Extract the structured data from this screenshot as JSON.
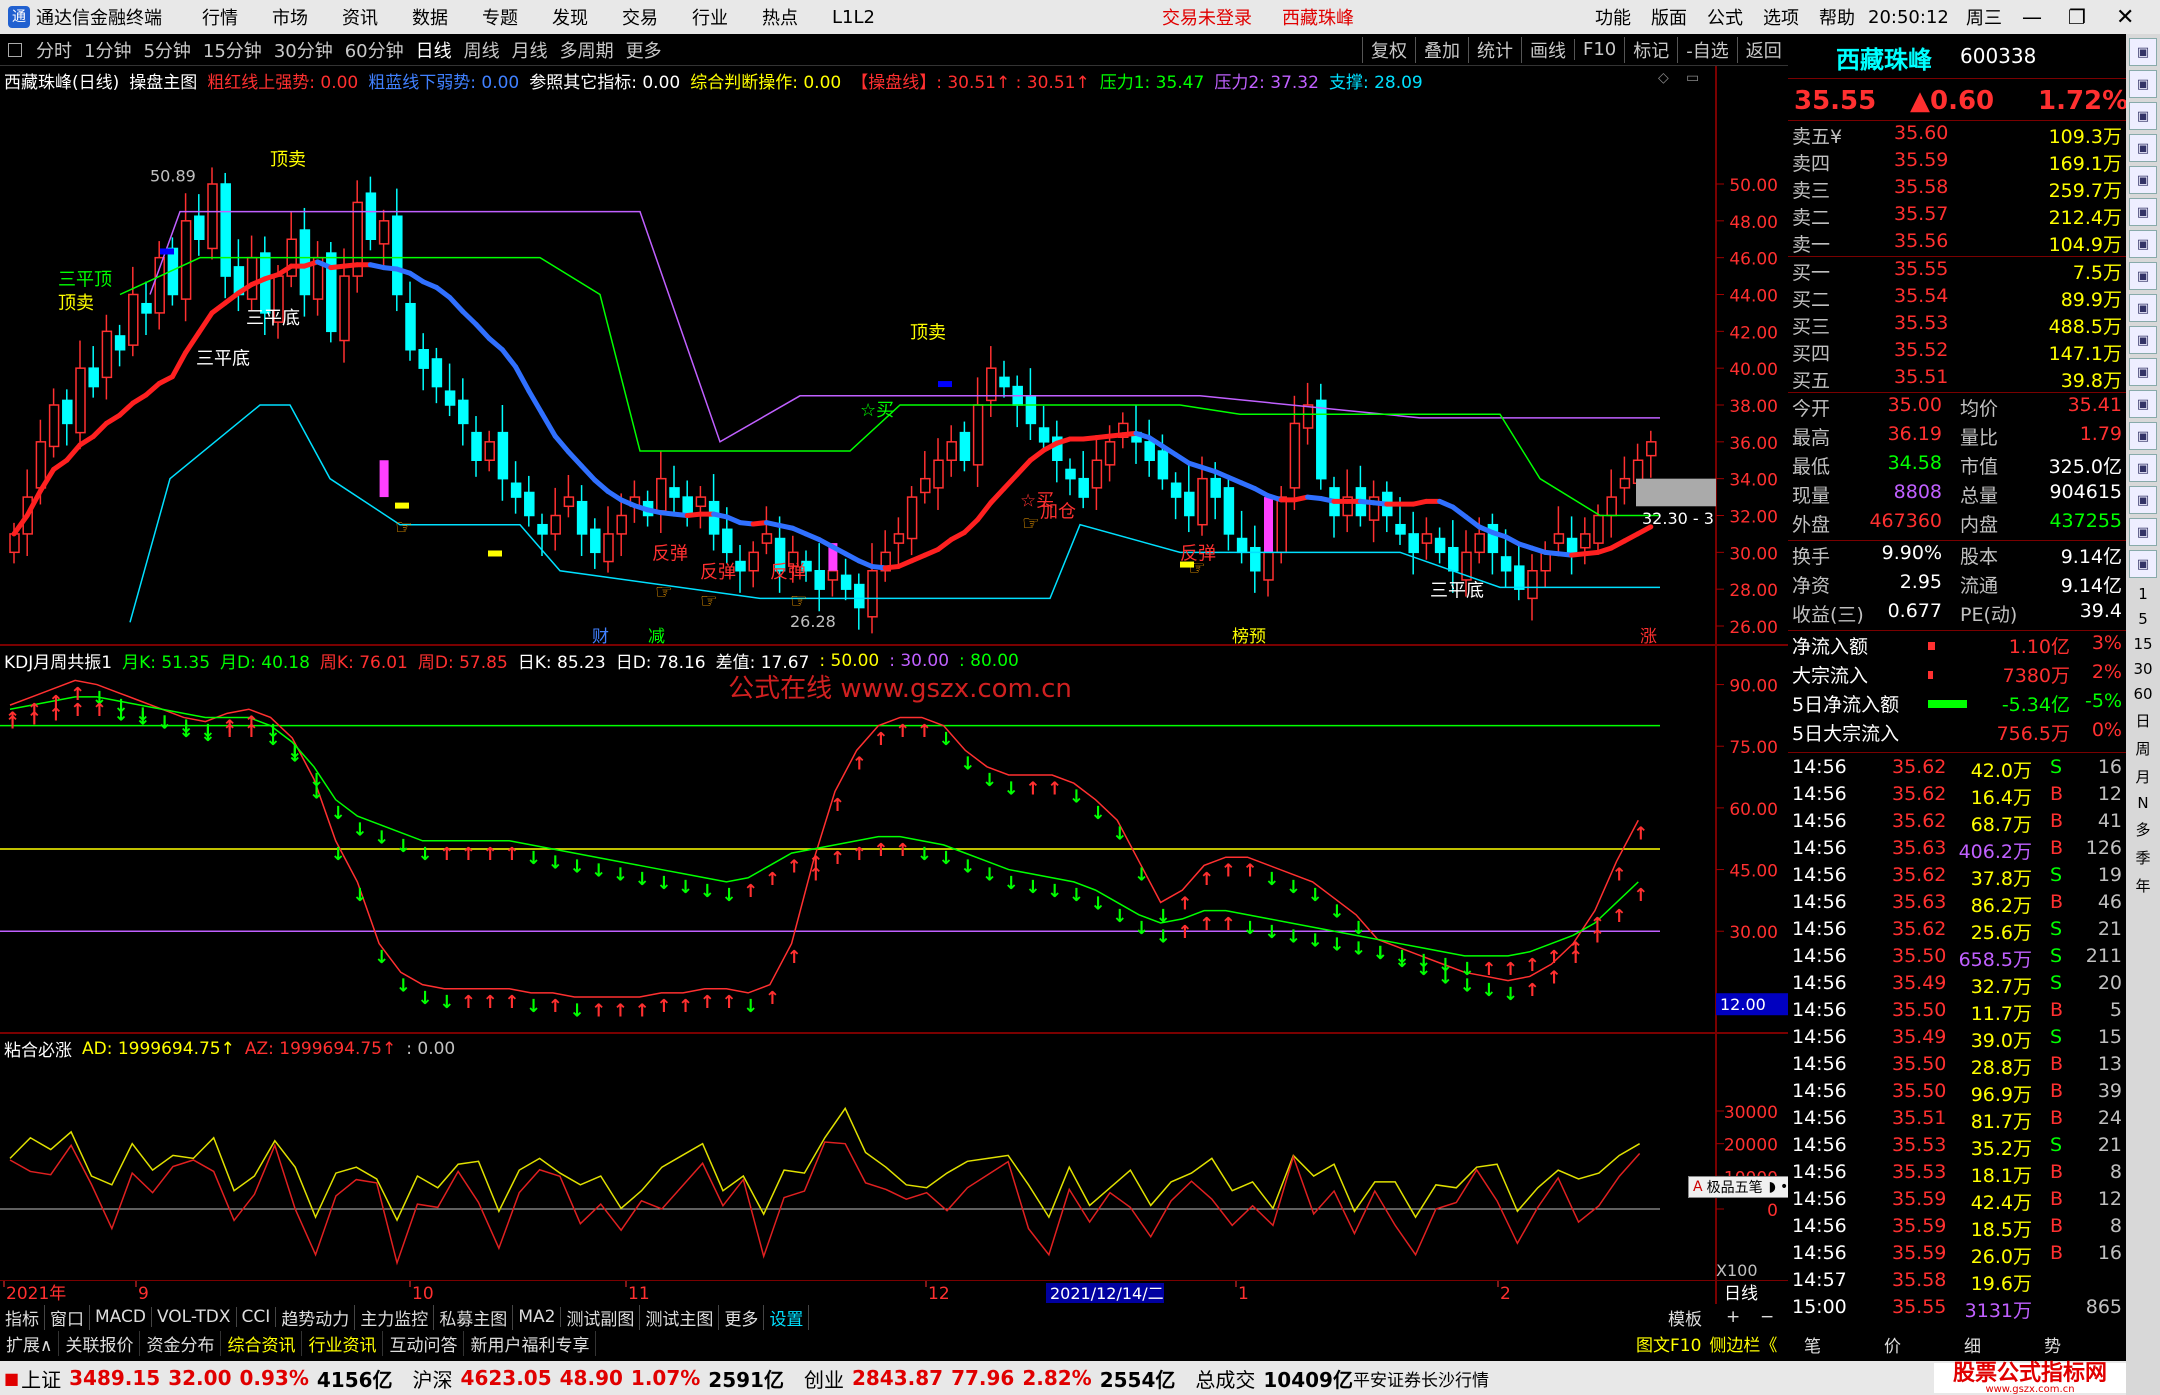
{
  "app": {
    "title": "通达信金融终端",
    "menus": [
      "行情",
      "市场",
      "资讯",
      "数据",
      "专题",
      "发现",
      "交易",
      "行业",
      "热点",
      "L1L2"
    ],
    "login_status": "交易未登录",
    "stock_tab": "西藏珠峰",
    "right_menus": [
      "功能",
      "版面",
      "公式",
      "选项",
      "帮助"
    ],
    "clock": "20:50:12",
    "weekday": "周三"
  },
  "toolbar": {
    "periods": [
      "分时",
      "1分钟",
      "5分钟",
      "15分钟",
      "30分钟",
      "60分钟",
      "日线",
      "周线",
      "月线",
      "多周期",
      "更多"
    ],
    "active": "日线",
    "right": [
      "复权",
      "叠加",
      "统计",
      "画线",
      "F10",
      "标记",
      "-自选",
      "返回"
    ]
  },
  "main_panel": {
    "title_items": [
      {
        "text": "西藏珠峰(日线)",
        "color": "#ffffff"
      },
      {
        "text": "操盘主图",
        "color": "#ffffff"
      },
      {
        "text": "粗红线上强势: 0.00",
        "color": "#ff3030"
      },
      {
        "text": "粗蓝线下弱势: 0.00",
        "color": "#4080ff"
      },
      {
        "text": "参照其它指标: 0.00",
        "color": "#ffffff"
      },
      {
        "text": "综合判断操作: 0.00",
        "color": "#ffff00"
      },
      {
        "text": "【操盘线】: 30.51↑ : 30.51↑",
        "color": "#ff3030"
      },
      {
        "text": "压力1: 35.47",
        "color": "#00ff00"
      },
      {
        "text": "压力2: 37.32",
        "color": "#c060ff"
      },
      {
        "text": "支撑: 28.09",
        "color": "#00e0ff"
      }
    ],
    "y_ticks": [
      "50.00",
      "48.00",
      "46.00",
      "44.00",
      "42.00",
      "40.00",
      "38.00",
      "36.00",
      "34.00",
      "32.00",
      "30.00",
      "28.00",
      "26.00"
    ],
    "high_label": "50.89",
    "low_label": "26.28",
    "price_box": "32.30 - 3",
    "signals": [
      {
        "text": "三平顶",
        "color": "#00ff00"
      },
      {
        "text": "顶卖",
        "color": "#ffff00"
      },
      {
        "text": "顶卖",
        "color": "#ffff00"
      },
      {
        "text": "三平底",
        "color": "#ffffff"
      },
      {
        "text": "三平底",
        "color": "#ffffff"
      },
      {
        "text": "顶卖",
        "color": "#ffff00"
      },
      {
        "text": "☆买",
        "color": "#00ff00"
      },
      {
        "text": "反弹",
        "color": "#ff3030"
      },
      {
        "text": "反弹",
        "color": "#ff3030"
      },
      {
        "text": "反弹",
        "color": "#ff3030"
      },
      {
        "text": "☆买",
        "color": "#ff3030"
      },
      {
        "text": "加仓",
        "color": "#ff3030"
      },
      {
        "text": "反弹",
        "color": "#ff3030"
      },
      {
        "text": "三平底",
        "color": "#ffffff"
      }
    ],
    "bottom_marks": [
      {
        "text": "财",
        "color": "#4080ff"
      },
      {
        "text": "减",
        "color": "#00ff00"
      },
      {
        "text": "榜预",
        "color": "#ffff00"
      },
      {
        "text": "涨",
        "color": "#ff3030"
      }
    ]
  },
  "kdj_panel": {
    "title_items": [
      {
        "text": "KDJ月周共振1",
        "color": "#ffffff"
      },
      {
        "text": "月K: 51.35",
        "color": "#00ff00"
      },
      {
        "text": "月D: 40.18",
        "color": "#00ff00"
      },
      {
        "text": "周K: 76.01",
        "color": "#ff3030"
      },
      {
        "text": "周D: 57.85",
        "color": "#ff3030"
      },
      {
        "text": "日K: 85.23",
        "color": "#ffffff"
      },
      {
        "text": "日D: 78.16",
        "color": "#ffffff"
      },
      {
        "text": "差值: 17.67",
        "color": "#ffffff"
      },
      {
        "text": ": 50.00",
        "color": "#ffff00"
      },
      {
        "text": ": 30.00",
        "color": "#c060ff"
      },
      {
        "text": ": 80.00",
        "color": "#00ff00"
      }
    ],
    "y_ticks": [
      "90.00",
      "75.00",
      "60.00",
      "45.00",
      "30.00"
    ],
    "side_value": "12.00",
    "watermark": "公式在线  www.gszx.com.cn"
  },
  "ad_panel": {
    "title_items": [
      {
        "text": "粘合必涨",
        "color": "#ffffff"
      },
      {
        "text": "AD: 1999694.75↑",
        "color": "#ffff00"
      },
      {
        "text": "AZ: 1999694.75↑",
        "color": "#ff3030"
      },
      {
        "text": ": 0.00",
        "color": "#c0c0c0"
      }
    ],
    "y_ticks": [
      "30000",
      "20000",
      "10000",
      "0"
    ],
    "multiplier": "X100",
    "overlay": [
      "极品五笔"
    ]
  },
  "x_axis": {
    "labels": [
      "2021年",
      "9",
      "10",
      "11",
      "12",
      "1",
      "2"
    ],
    "cursor": "2021/12/14/二",
    "period": "日线"
  },
  "quote": {
    "name": "西藏珠峰",
    "code": "600338",
    "price": "35.55",
    "change": "▲0.60",
    "pct": "1.72%",
    "asks": [
      {
        "label": "卖五¥",
        "price": "35.60",
        "vol": "109.3万"
      },
      {
        "label": "卖四",
        "price": "35.59",
        "vol": "169.1万"
      },
      {
        "label": "卖三",
        "price": "35.58",
        "vol": "259.7万"
      },
      {
        "label": "卖二",
        "price": "35.57",
        "vol": "212.4万"
      },
      {
        "label": "卖一",
        "price": "35.56",
        "vol": "104.9万"
      }
    ],
    "bids": [
      {
        "label": "买一",
        "price": "35.55",
        "vol": "7.5万"
      },
      {
        "label": "买二",
        "price": "35.54",
        "vol": "89.9万"
      },
      {
        "label": "买三",
        "price": "35.53",
        "vol": "488.5万"
      },
      {
        "label": "买四",
        "price": "35.52",
        "vol": "147.1万"
      },
      {
        "label": "买五",
        "price": "35.51",
        "vol": "39.8万"
      }
    ],
    "stats": [
      {
        "l1": "今开",
        "v1": "35.00",
        "c1": "#ff3030",
        "l2": "均价",
        "v2": "35.41",
        "c2": "#ff3030"
      },
      {
        "l1": "最高",
        "v1": "36.19",
        "c1": "#ff3030",
        "l2": "量比",
        "v2": "1.79",
        "c2": "#ff3030"
      },
      {
        "l1": "最低",
        "v1": "34.58",
        "c1": "#00ff00",
        "l2": "市值",
        "v2": "325.0亿",
        "c2": "#ffffff"
      },
      {
        "l1": "现量",
        "v1": "8808",
        "c1": "#c060ff",
        "l2": "总量",
        "v2": "904615",
        "c2": "#ffffff"
      },
      {
        "l1": "外盘",
        "v1": "467360",
        "c1": "#ff3030",
        "l2": "内盘",
        "v2": "437255",
        "c2": "#00ff00"
      }
    ],
    "stats2": [
      {
        "l1": "换手",
        "v1": "9.90%",
        "c1": "#ffffff",
        "l2": "股本",
        "v2": "9.14亿",
        "c2": "#ffffff"
      },
      {
        "l1": "净资",
        "v1": "2.95",
        "c1": "#ffffff",
        "l2": "流通",
        "v2": "9.14亿",
        "c2": "#ffffff"
      },
      {
        "l1": "收益(三)",
        "v1": "0.677",
        "c1": "#ffffff",
        "l2": "PE(动)",
        "v2": "39.4",
        "c2": "#ffffff"
      }
    ],
    "flows": [
      {
        "label": "净流入额",
        "value": "1.10亿",
        "pct": "3%",
        "color": "#ff3030",
        "bar": 0.1
      },
      {
        "label": "大宗流入",
        "value": "7380万",
        "pct": "2%",
        "color": "#ff3030",
        "bar": 0.07
      },
      {
        "label": "5日净流入额",
        "value": "-5.34亿",
        "pct": "-5%",
        "color": "#00ff00",
        "bar": 0.55
      },
      {
        "label": "5日大宗流入",
        "value": "756.5万",
        "pct": "0%",
        "color": "#ff3030",
        "bar": 0
      }
    ],
    "ticks": [
      {
        "t": "14:56",
        "p": "35.62",
        "v": "42.0万",
        "s": "S",
        "n": "16",
        "vc": "#ffff00"
      },
      {
        "t": "14:56",
        "p": "35.62",
        "v": "16.4万",
        "s": "B",
        "n": "12",
        "vc": "#ffff00"
      },
      {
        "t": "14:56",
        "p": "35.62",
        "v": "68.7万",
        "s": "B",
        "n": "41",
        "vc": "#ffff00"
      },
      {
        "t": "14:56",
        "p": "35.63",
        "v": "406.2万",
        "s": "B",
        "n": "126",
        "vc": "#c060ff"
      },
      {
        "t": "14:56",
        "p": "35.62",
        "v": "37.8万",
        "s": "S",
        "n": "19",
        "vc": "#ffff00"
      },
      {
        "t": "14:56",
        "p": "35.63",
        "v": "86.2万",
        "s": "B",
        "n": "46",
        "vc": "#ffff00"
      },
      {
        "t": "14:56",
        "p": "35.62",
        "v": "25.6万",
        "s": "S",
        "n": "21",
        "vc": "#ffff00"
      },
      {
        "t": "14:56",
        "p": "35.50",
        "v": "658.5万",
        "s": "S",
        "n": "211",
        "vc": "#c060ff"
      },
      {
        "t": "14:56",
        "p": "35.49",
        "v": "32.7万",
        "s": "S",
        "n": "20",
        "vc": "#ffff00"
      },
      {
        "t": "14:56",
        "p": "35.50",
        "v": "11.7万",
        "s": "B",
        "n": "5",
        "vc": "#ffff00"
      },
      {
        "t": "14:56",
        "p": "35.49",
        "v": "39.0万",
        "s": "S",
        "n": "15",
        "vc": "#ffff00"
      },
      {
        "t": "14:56",
        "p": "35.50",
        "v": "28.8万",
        "s": "B",
        "n": "13",
        "vc": "#ffff00"
      },
      {
        "t": "14:56",
        "p": "35.50",
        "v": "96.9万",
        "s": "B",
        "n": "39",
        "vc": "#ffff00"
      },
      {
        "t": "14:56",
        "p": "35.51",
        "v": "81.7万",
        "s": "B",
        "n": "24",
        "vc": "#ffff00"
      },
      {
        "t": "14:56",
        "p": "35.53",
        "v": "35.2万",
        "s": "S",
        "n": "21",
        "vc": "#ffff00"
      },
      {
        "t": "14:56",
        "p": "35.53",
        "v": "18.1万",
        "s": "B",
        "n": "8",
        "vc": "#ffff00"
      },
      {
        "t": "14:56",
        "p": "35.59",
        "v": "42.4万",
        "s": "B",
        "n": "12",
        "vc": "#ffff00"
      },
      {
        "t": "14:56",
        "p": "35.59",
        "v": "18.5万",
        "s": "B",
        "n": "8",
        "vc": "#ffff00"
      },
      {
        "t": "14:56",
        "p": "35.59",
        "v": "26.0万",
        "s": "B",
        "n": "16",
        "vc": "#ffff00"
      },
      {
        "t": "14:57",
        "p": "35.58",
        "v": "19.6万",
        "s": "",
        "n": "",
        "vc": "#ffff00"
      },
      {
        "t": "15:00",
        "p": "35.55",
        "v": "3131万",
        "s": "",
        "n": "865",
        "vc": "#c060ff"
      }
    ],
    "right_tabs": [
      "笔",
      "价",
      "细",
      "势"
    ],
    "right_tab_prefix": [
      "图文F10",
      "侧边栏《"
    ]
  },
  "sidebar": {
    "icons": [
      "up-arrow",
      "down-arrow",
      "prev",
      "next",
      "table",
      "chart",
      "candle",
      "list",
      "f10",
      "bars",
      "f10b",
      "link",
      "grid",
      "rsi",
      "arrows",
      "pen",
      "f5"
    ],
    "texts": [
      "1",
      "5",
      "15",
      "30",
      "60",
      "日",
      "周",
      "月",
      "N",
      "多",
      "季",
      "年"
    ]
  },
  "bottom": {
    "tabs": [
      "指标",
      "窗口",
      "MACD",
      "VOL-TDX",
      "CCI",
      "趋势动力",
      "主力监控",
      "私募主图",
      "MA2",
      "测试副图",
      "测试主图",
      "更多",
      "设置"
    ],
    "active_tab": "设置",
    "template": "模板",
    "info_tabs": [
      "扩展∧",
      "关联报价",
      "资金分布",
      "综合资讯",
      "行业资讯",
      "互动问答",
      "新用户福利专享"
    ]
  },
  "status": {
    "sh_label": "上证",
    "sh_val": "3489.15",
    "sh_chg": "32.00",
    "sh_pct": "0.93%",
    "sh_amt": "4156亿",
    "sz_label": "沪深",
    "sz_val": "4623.05",
    "sz_chg": "48.90",
    "sz_pct": "1.07%",
    "sz_amt": "2591亿",
    "cy_label": "创业",
    "cy_val": "2843.87",
    "cy_chg": "77.96",
    "cy_pct": "2.82%",
    "cy_amt": "2554亿",
    "total_label": "总成交",
    "total_val": "10409亿",
    "broker": "平安证券长沙行情",
    "brand": "股票公式指标网",
    "brand_url": "www.gszx.com.cn"
  },
  "colors": {
    "up": "#ff3030",
    "down": "#00ffff",
    "green": "#00ff00",
    "yellow": "#ffff00",
    "purple": "#c060ff",
    "blue": "#3070ff",
    "frame": "#7a0000"
  }
}
